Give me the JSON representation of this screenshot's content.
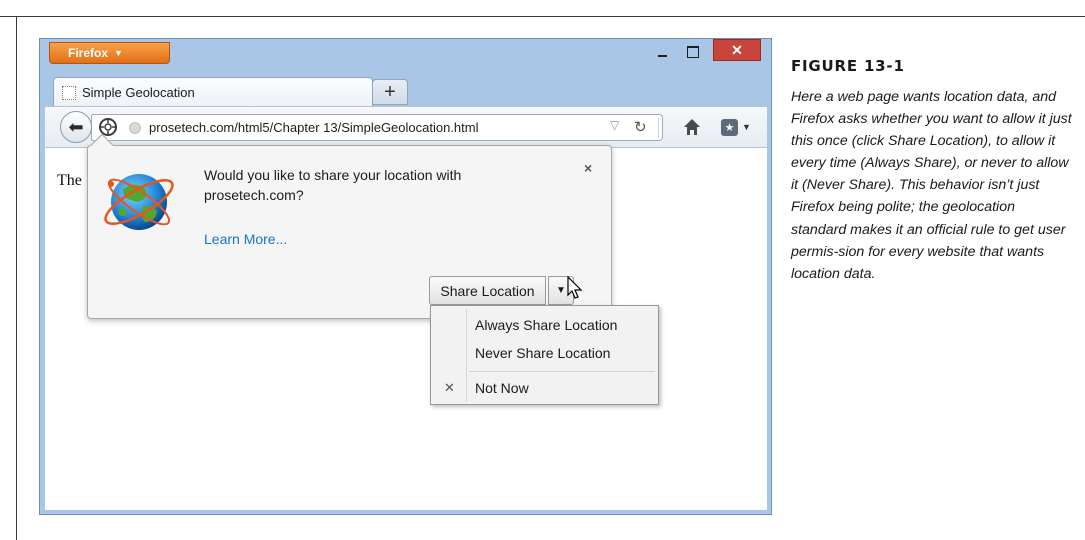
{
  "browser": {
    "app_button_label": "Firefox",
    "tab_title": "Simple Geolocation",
    "new_tab_label": "+",
    "url": "prosetech.com/html5/Chapter 13/SimpleGeolocation.html"
  },
  "page": {
    "visible_text": "The"
  },
  "geolocation_prompt": {
    "message": "Would you like to share your location with prosetech.com?",
    "learn_more": "Learn More...",
    "close_label": "×",
    "share_button": "Share Location",
    "menu_items": [
      {
        "label": "Always Share Location"
      },
      {
        "label": "Never Share Location"
      },
      {
        "label": "Not Now"
      }
    ]
  },
  "figure": {
    "title": "FIGURE 13-1",
    "caption": "Here a web page wants location data, and Firefox asks whether you want to allow it just this once (click Share Location), to allow it every time (Always Share), or never to allow it (Never Share). This behavior isn’t just Firefox being polite; the geolocation standard makes it an official rule to get user permis-sion for every website that wants location data."
  }
}
